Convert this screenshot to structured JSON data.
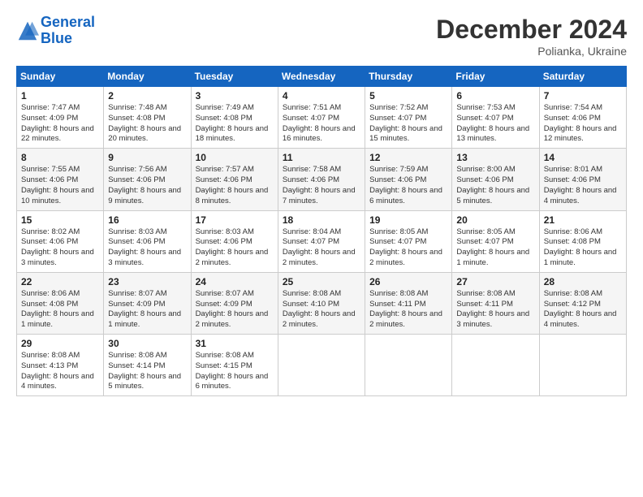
{
  "header": {
    "logo_line1": "General",
    "logo_line2": "Blue",
    "title": "December 2024",
    "subtitle": "Polianka, Ukraine"
  },
  "columns": [
    "Sunday",
    "Monday",
    "Tuesday",
    "Wednesday",
    "Thursday",
    "Friday",
    "Saturday"
  ],
  "weeks": [
    [
      {
        "day": "1",
        "sunrise": "7:47 AM",
        "sunset": "4:09 PM",
        "daylight": "8 hours and 22 minutes."
      },
      {
        "day": "2",
        "sunrise": "7:48 AM",
        "sunset": "4:08 PM",
        "daylight": "8 hours and 20 minutes."
      },
      {
        "day": "3",
        "sunrise": "7:49 AM",
        "sunset": "4:08 PM",
        "daylight": "8 hours and 18 minutes."
      },
      {
        "day": "4",
        "sunrise": "7:51 AM",
        "sunset": "4:07 PM",
        "daylight": "8 hours and 16 minutes."
      },
      {
        "day": "5",
        "sunrise": "7:52 AM",
        "sunset": "4:07 PM",
        "daylight": "8 hours and 15 minutes."
      },
      {
        "day": "6",
        "sunrise": "7:53 AM",
        "sunset": "4:07 PM",
        "daylight": "8 hours and 13 minutes."
      },
      {
        "day": "7",
        "sunrise": "7:54 AM",
        "sunset": "4:06 PM",
        "daylight": "8 hours and 12 minutes."
      }
    ],
    [
      {
        "day": "8",
        "sunrise": "7:55 AM",
        "sunset": "4:06 PM",
        "daylight": "8 hours and 10 minutes."
      },
      {
        "day": "9",
        "sunrise": "7:56 AM",
        "sunset": "4:06 PM",
        "daylight": "8 hours and 9 minutes."
      },
      {
        "day": "10",
        "sunrise": "7:57 AM",
        "sunset": "4:06 PM",
        "daylight": "8 hours and 8 minutes."
      },
      {
        "day": "11",
        "sunrise": "7:58 AM",
        "sunset": "4:06 PM",
        "daylight": "8 hours and 7 minutes."
      },
      {
        "day": "12",
        "sunrise": "7:59 AM",
        "sunset": "4:06 PM",
        "daylight": "8 hours and 6 minutes."
      },
      {
        "day": "13",
        "sunrise": "8:00 AM",
        "sunset": "4:06 PM",
        "daylight": "8 hours and 5 minutes."
      },
      {
        "day": "14",
        "sunrise": "8:01 AM",
        "sunset": "4:06 PM",
        "daylight": "8 hours and 4 minutes."
      }
    ],
    [
      {
        "day": "15",
        "sunrise": "8:02 AM",
        "sunset": "4:06 PM",
        "daylight": "8 hours and 3 minutes."
      },
      {
        "day": "16",
        "sunrise": "8:03 AM",
        "sunset": "4:06 PM",
        "daylight": "8 hours and 3 minutes."
      },
      {
        "day": "17",
        "sunrise": "8:03 AM",
        "sunset": "4:06 PM",
        "daylight": "8 hours and 2 minutes."
      },
      {
        "day": "18",
        "sunrise": "8:04 AM",
        "sunset": "4:07 PM",
        "daylight": "8 hours and 2 minutes."
      },
      {
        "day": "19",
        "sunrise": "8:05 AM",
        "sunset": "4:07 PM",
        "daylight": "8 hours and 2 minutes."
      },
      {
        "day": "20",
        "sunrise": "8:05 AM",
        "sunset": "4:07 PM",
        "daylight": "8 hours and 1 minute."
      },
      {
        "day": "21",
        "sunrise": "8:06 AM",
        "sunset": "4:08 PM",
        "daylight": "8 hours and 1 minute."
      }
    ],
    [
      {
        "day": "22",
        "sunrise": "8:06 AM",
        "sunset": "4:08 PM",
        "daylight": "8 hours and 1 minute."
      },
      {
        "day": "23",
        "sunrise": "8:07 AM",
        "sunset": "4:09 PM",
        "daylight": "8 hours and 1 minute."
      },
      {
        "day": "24",
        "sunrise": "8:07 AM",
        "sunset": "4:09 PM",
        "daylight": "8 hours and 2 minutes."
      },
      {
        "day": "25",
        "sunrise": "8:08 AM",
        "sunset": "4:10 PM",
        "daylight": "8 hours and 2 minutes."
      },
      {
        "day": "26",
        "sunrise": "8:08 AM",
        "sunset": "4:11 PM",
        "daylight": "8 hours and 2 minutes."
      },
      {
        "day": "27",
        "sunrise": "8:08 AM",
        "sunset": "4:11 PM",
        "daylight": "8 hours and 3 minutes."
      },
      {
        "day": "28",
        "sunrise": "8:08 AM",
        "sunset": "4:12 PM",
        "daylight": "8 hours and 4 minutes."
      }
    ],
    [
      {
        "day": "29",
        "sunrise": "8:08 AM",
        "sunset": "4:13 PM",
        "daylight": "8 hours and 4 minutes."
      },
      {
        "day": "30",
        "sunrise": "8:08 AM",
        "sunset": "4:14 PM",
        "daylight": "8 hours and 5 minutes."
      },
      {
        "day": "31",
        "sunrise": "8:08 AM",
        "sunset": "4:15 PM",
        "daylight": "8 hours and 6 minutes."
      },
      null,
      null,
      null,
      null
    ]
  ],
  "labels": {
    "sunrise": "Sunrise: ",
    "sunset": "Sunset: ",
    "daylight": "Daylight: "
  }
}
